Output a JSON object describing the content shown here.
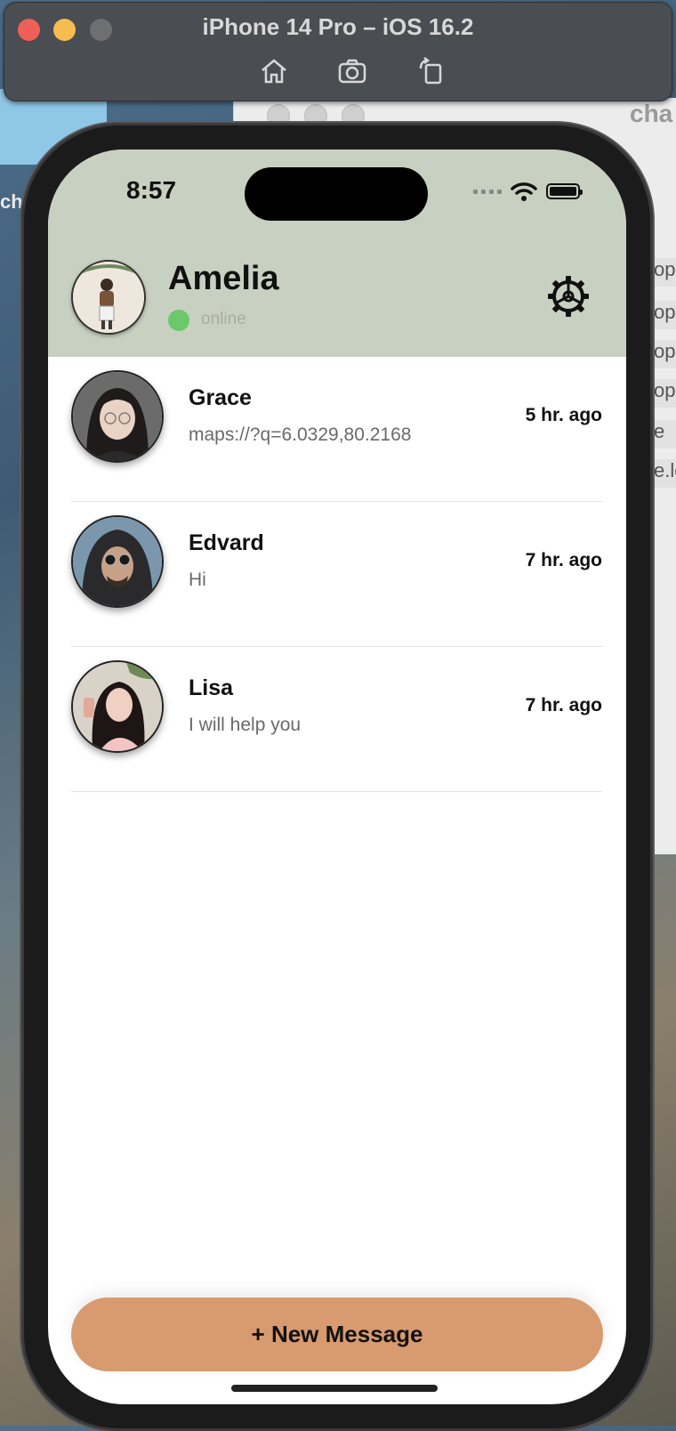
{
  "simulator": {
    "title": "iPhone 14 Pro – iOS 16.2",
    "toolbar": [
      "home-icon",
      "screenshot-icon",
      "rotate-icon"
    ]
  },
  "background": {
    "window_title_fragment": "cha",
    "left_text_fragment": "ch",
    "side_rows": [
      "op",
      "op",
      "op",
      "op",
      "e",
      "e.lo"
    ]
  },
  "status_bar": {
    "time": "8:57"
  },
  "profile": {
    "name": "Amelia",
    "status": "online",
    "status_color": "#6bc86b"
  },
  "chats": [
    {
      "name": "Grace",
      "last_message": "maps://?q=6.0329,80.2168",
      "time": "5 hr. ago"
    },
    {
      "name": "Edvard",
      "last_message": "Hi",
      "time": "7 hr. ago"
    },
    {
      "name": "Lisa",
      "last_message": "I will help you",
      "time": "7 hr. ago"
    }
  ],
  "actions": {
    "new_message_label": "+ New Message",
    "new_message_color": "#d89a6f"
  },
  "theme": {
    "header_color": "#c8d1c1"
  }
}
